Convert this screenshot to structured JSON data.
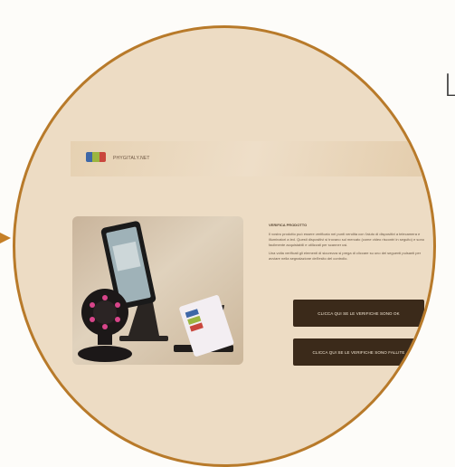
{
  "top_letter": "L",
  "header": {
    "brand": "PHYGITALY.NET",
    "logo_icon": "phygitaly-logo-icon"
  },
  "main": {
    "title": "VERIFICA PRODOTTO",
    "paragraph1": "Il vostro prodotto può essere verificato nei punti vendita con l'aiuto di dispositivi a telecamera e illuminatori a led. Questi dispositivi si trovano sul mercato (come video riscontri in seguito) e sono facilmente acquistabili e utilizzati per scanner usi.",
    "paragraph2": "Una volta verificati gli elementi di sicurezza si prega di cliccare su uno dei seguenti pulsanti per avviare nella segnalazione dell'esito del controllo.",
    "button_ok": "CLICCA QUI SE LE VERIFICHE SONO OK",
    "button_fail": "CLICCA QUI SE LE VERIFICHE SONO FALLITE"
  },
  "colors": {
    "circle_border": "#b87a2a",
    "circle_fill": "#eddcc4",
    "button_bg": "#3b2a1a",
    "arrow": "#c57f27"
  }
}
